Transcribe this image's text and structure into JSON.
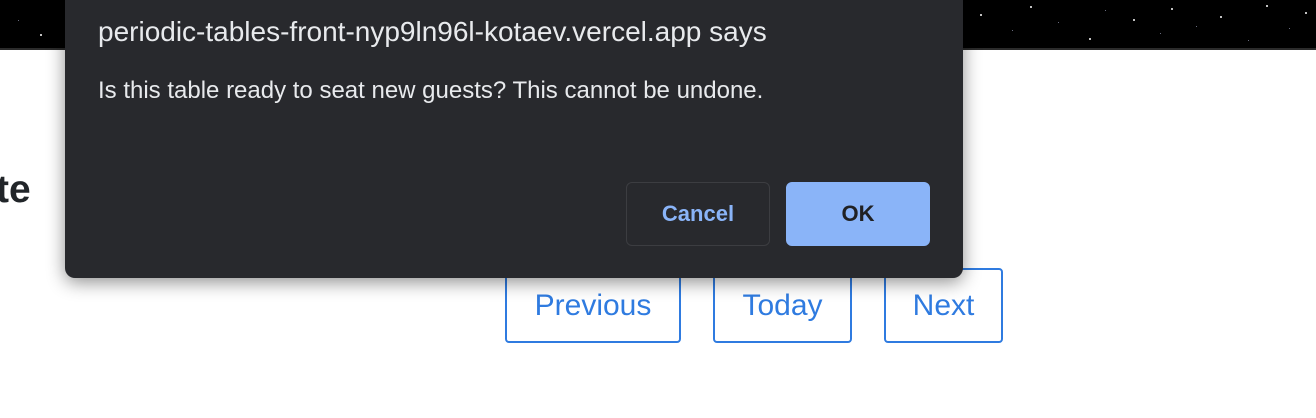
{
  "page": {
    "heading_fragment": "te",
    "nav": {
      "previous_label": "Previous",
      "today_label": "Today",
      "next_label": "Next"
    }
  },
  "dialog": {
    "title": "periodic-tables-front-nyp9ln96l-kotaev.vercel.app says",
    "message": "Is this table ready to seat new guests? This cannot be undone.",
    "cancel_label": "Cancel",
    "ok_label": "OK"
  },
  "colors": {
    "dialog_background": "#28292d",
    "dialog_text": "#e8eaed",
    "ok_button": "#8ab4f8",
    "cancel_text": "#8ab4f8",
    "nav_accent": "#2f7be0",
    "banner": "#000000"
  }
}
